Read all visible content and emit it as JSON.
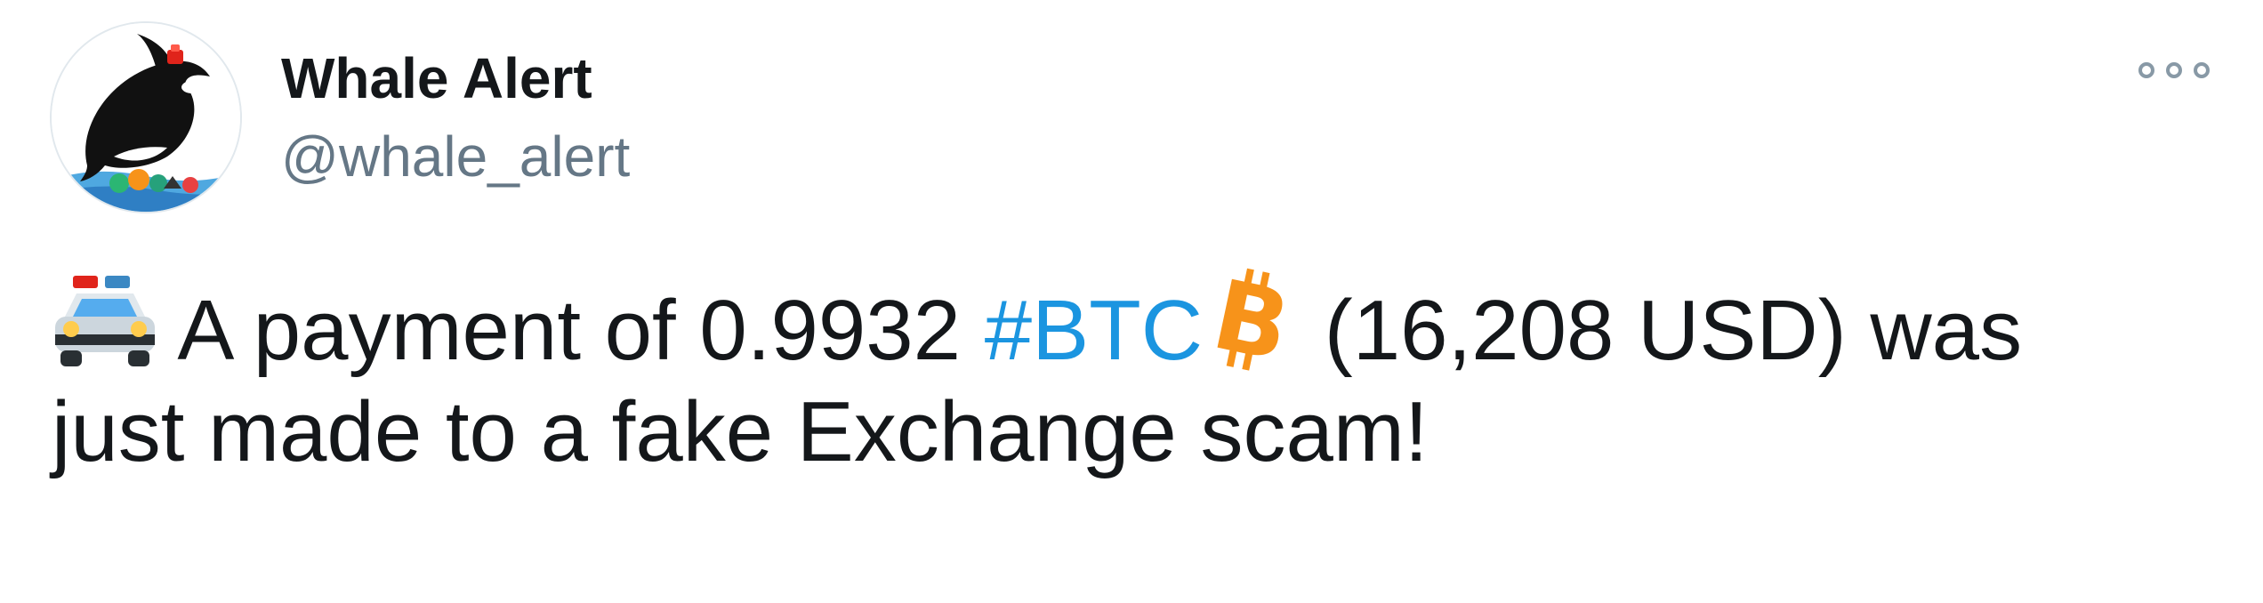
{
  "tweet": {
    "author": {
      "name": "Whale Alert",
      "handle": "@whale_alert",
      "avatar_icon": "orca-whale-logo-icon"
    },
    "more_icon": "more-options-icon",
    "text": {
      "emoji_police_car": "police-car-emoji",
      "part1": "A payment of 0.9932",
      "hashtag": "#BTC",
      "emoji_bitcoin": "bitcoin-symbol-emoji",
      "part2": "(16,208 USD) was",
      "line2": "just made to a fake Exchange scam!"
    },
    "colors": {
      "text": "#14171a",
      "handle": "#657786",
      "hashtag": "#1b95e0",
      "bitcoin": "#f7931a"
    }
  }
}
